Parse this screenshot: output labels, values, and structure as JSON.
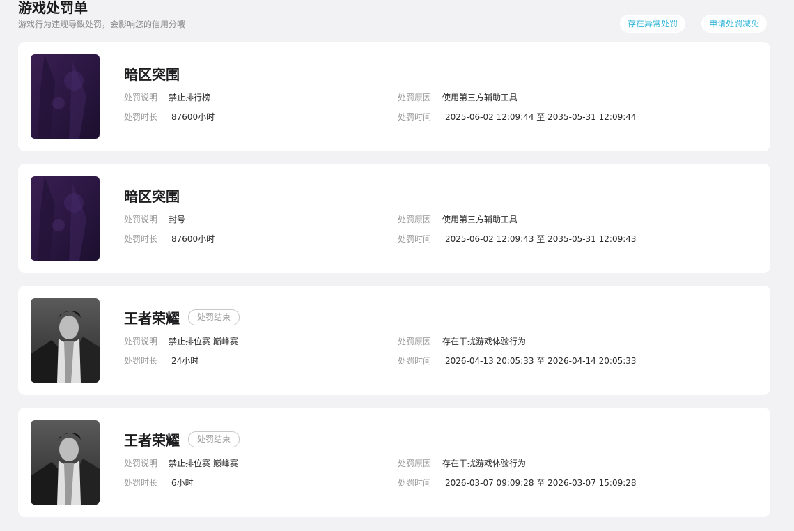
{
  "header": {
    "title": "游戏处罚单",
    "subtitle": "游戏行为违规导致处罚，会影响您的信用分哦",
    "btn_abnormal": "存在异常处罚",
    "btn_reduce": "申请处罚减免"
  },
  "labels": {
    "desc": "处罚说明",
    "duration": "处罚时长",
    "reason": "处罚原因",
    "time": "处罚时间"
  },
  "penalties": [
    {
      "game": "暗区突围",
      "thumb_icon": "game-cover-dark-zone",
      "status": "",
      "desc": "禁止排行榜",
      "duration": "87600小时",
      "reason": "使用第三方辅助工具",
      "time": "2025-06-02 12:09:44 至 2035-05-31 12:09:44"
    },
    {
      "game": "暗区突围",
      "thumb_icon": "game-cover-dark-zone",
      "status": "",
      "desc": "封号",
      "duration": "87600小时",
      "reason": "使用第三方辅助工具",
      "time": "2025-06-02 12:09:43 至 2035-05-31 12:09:43"
    },
    {
      "game": "王者荣耀",
      "thumb_icon": "game-cover-hero-grayscale",
      "status": "处罚结束",
      "desc": "禁止排位赛 巅峰赛",
      "duration": "24小时",
      "reason": "存在干扰游戏体验行为",
      "time": "2026-04-13 20:05:33 至 2026-04-14 20:05:33"
    },
    {
      "game": "王者荣耀",
      "thumb_icon": "game-cover-hero-grayscale",
      "status": "处罚结束",
      "desc": "禁止排位赛 巅峰赛",
      "duration": "6小时",
      "reason": "存在干扰游戏体验行为",
      "time": "2026-03-07 09:09:28 至 2026-03-07 15:09:28"
    }
  ],
  "colors": {
    "accent": "#31b6d8",
    "card_bg": "#ffffff",
    "page_bg": "#f2f2f4",
    "label_gray": "#9a9a9a"
  }
}
